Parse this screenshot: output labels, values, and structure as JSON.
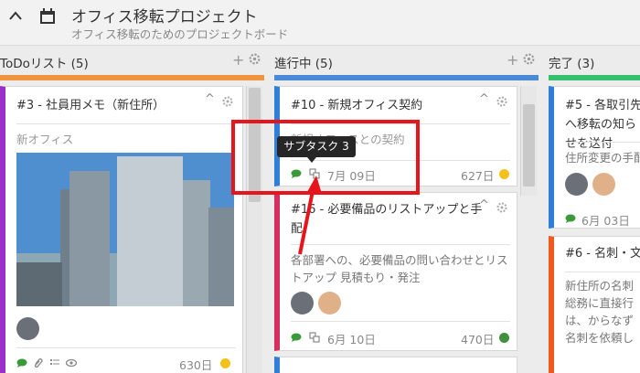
{
  "header": {
    "title": "オフィス移転プロジェクト",
    "subtitle": "オフィス移転のためのプロジェクトボード"
  },
  "columns": [
    {
      "name": "ToDoリスト (5)",
      "color": "#f0943f",
      "card": {
        "title": "#3 - 社員用メモ（新住所）",
        "description": "新オフィス",
        "accent": "#9b2fc9",
        "days": "630日",
        "status_color": "#f2c21b",
        "icons": [
          "comment-icon",
          "attachment-icon",
          "checklist-icon",
          "eye-icon"
        ]
      }
    },
    {
      "name": "進行中 (5)",
      "color": "#4a89d6",
      "cards": [
        {
          "title": "#10 - 新規オフィス契約",
          "description": "新規オフィスとの契約",
          "accent": "#2f7fd8",
          "date": "7月 09日",
          "days": "627日",
          "status_color": "#f2c21b"
        },
        {
          "title": "#16 - 必要備品のリストアップと手配",
          "description": "各部署への、必要備品の問い合わせとリストアップ 見積もり・発注",
          "accent": "#d42f5e",
          "date": "6月 10日",
          "days": "470日",
          "status_color": "#3f8f3f"
        }
      ]
    },
    {
      "name": "完了 (3)",
      "color": "#35c06d",
      "cards": [
        {
          "title": "#5 - 各取引先へ移転の知らせを送付",
          "description": "住所変更の手配",
          "accent": "#2f7fd8",
          "date": "6月 03日"
        },
        {
          "title": "#6 - 名刺・文",
          "description": "新住所の名刺 総務に直接行 は、からなず 名刺を依頼し",
          "accent": "#f05a1e"
        }
      ]
    }
  ],
  "tooltip": "サブタスク 3",
  "annotation_color": "#e8141b"
}
